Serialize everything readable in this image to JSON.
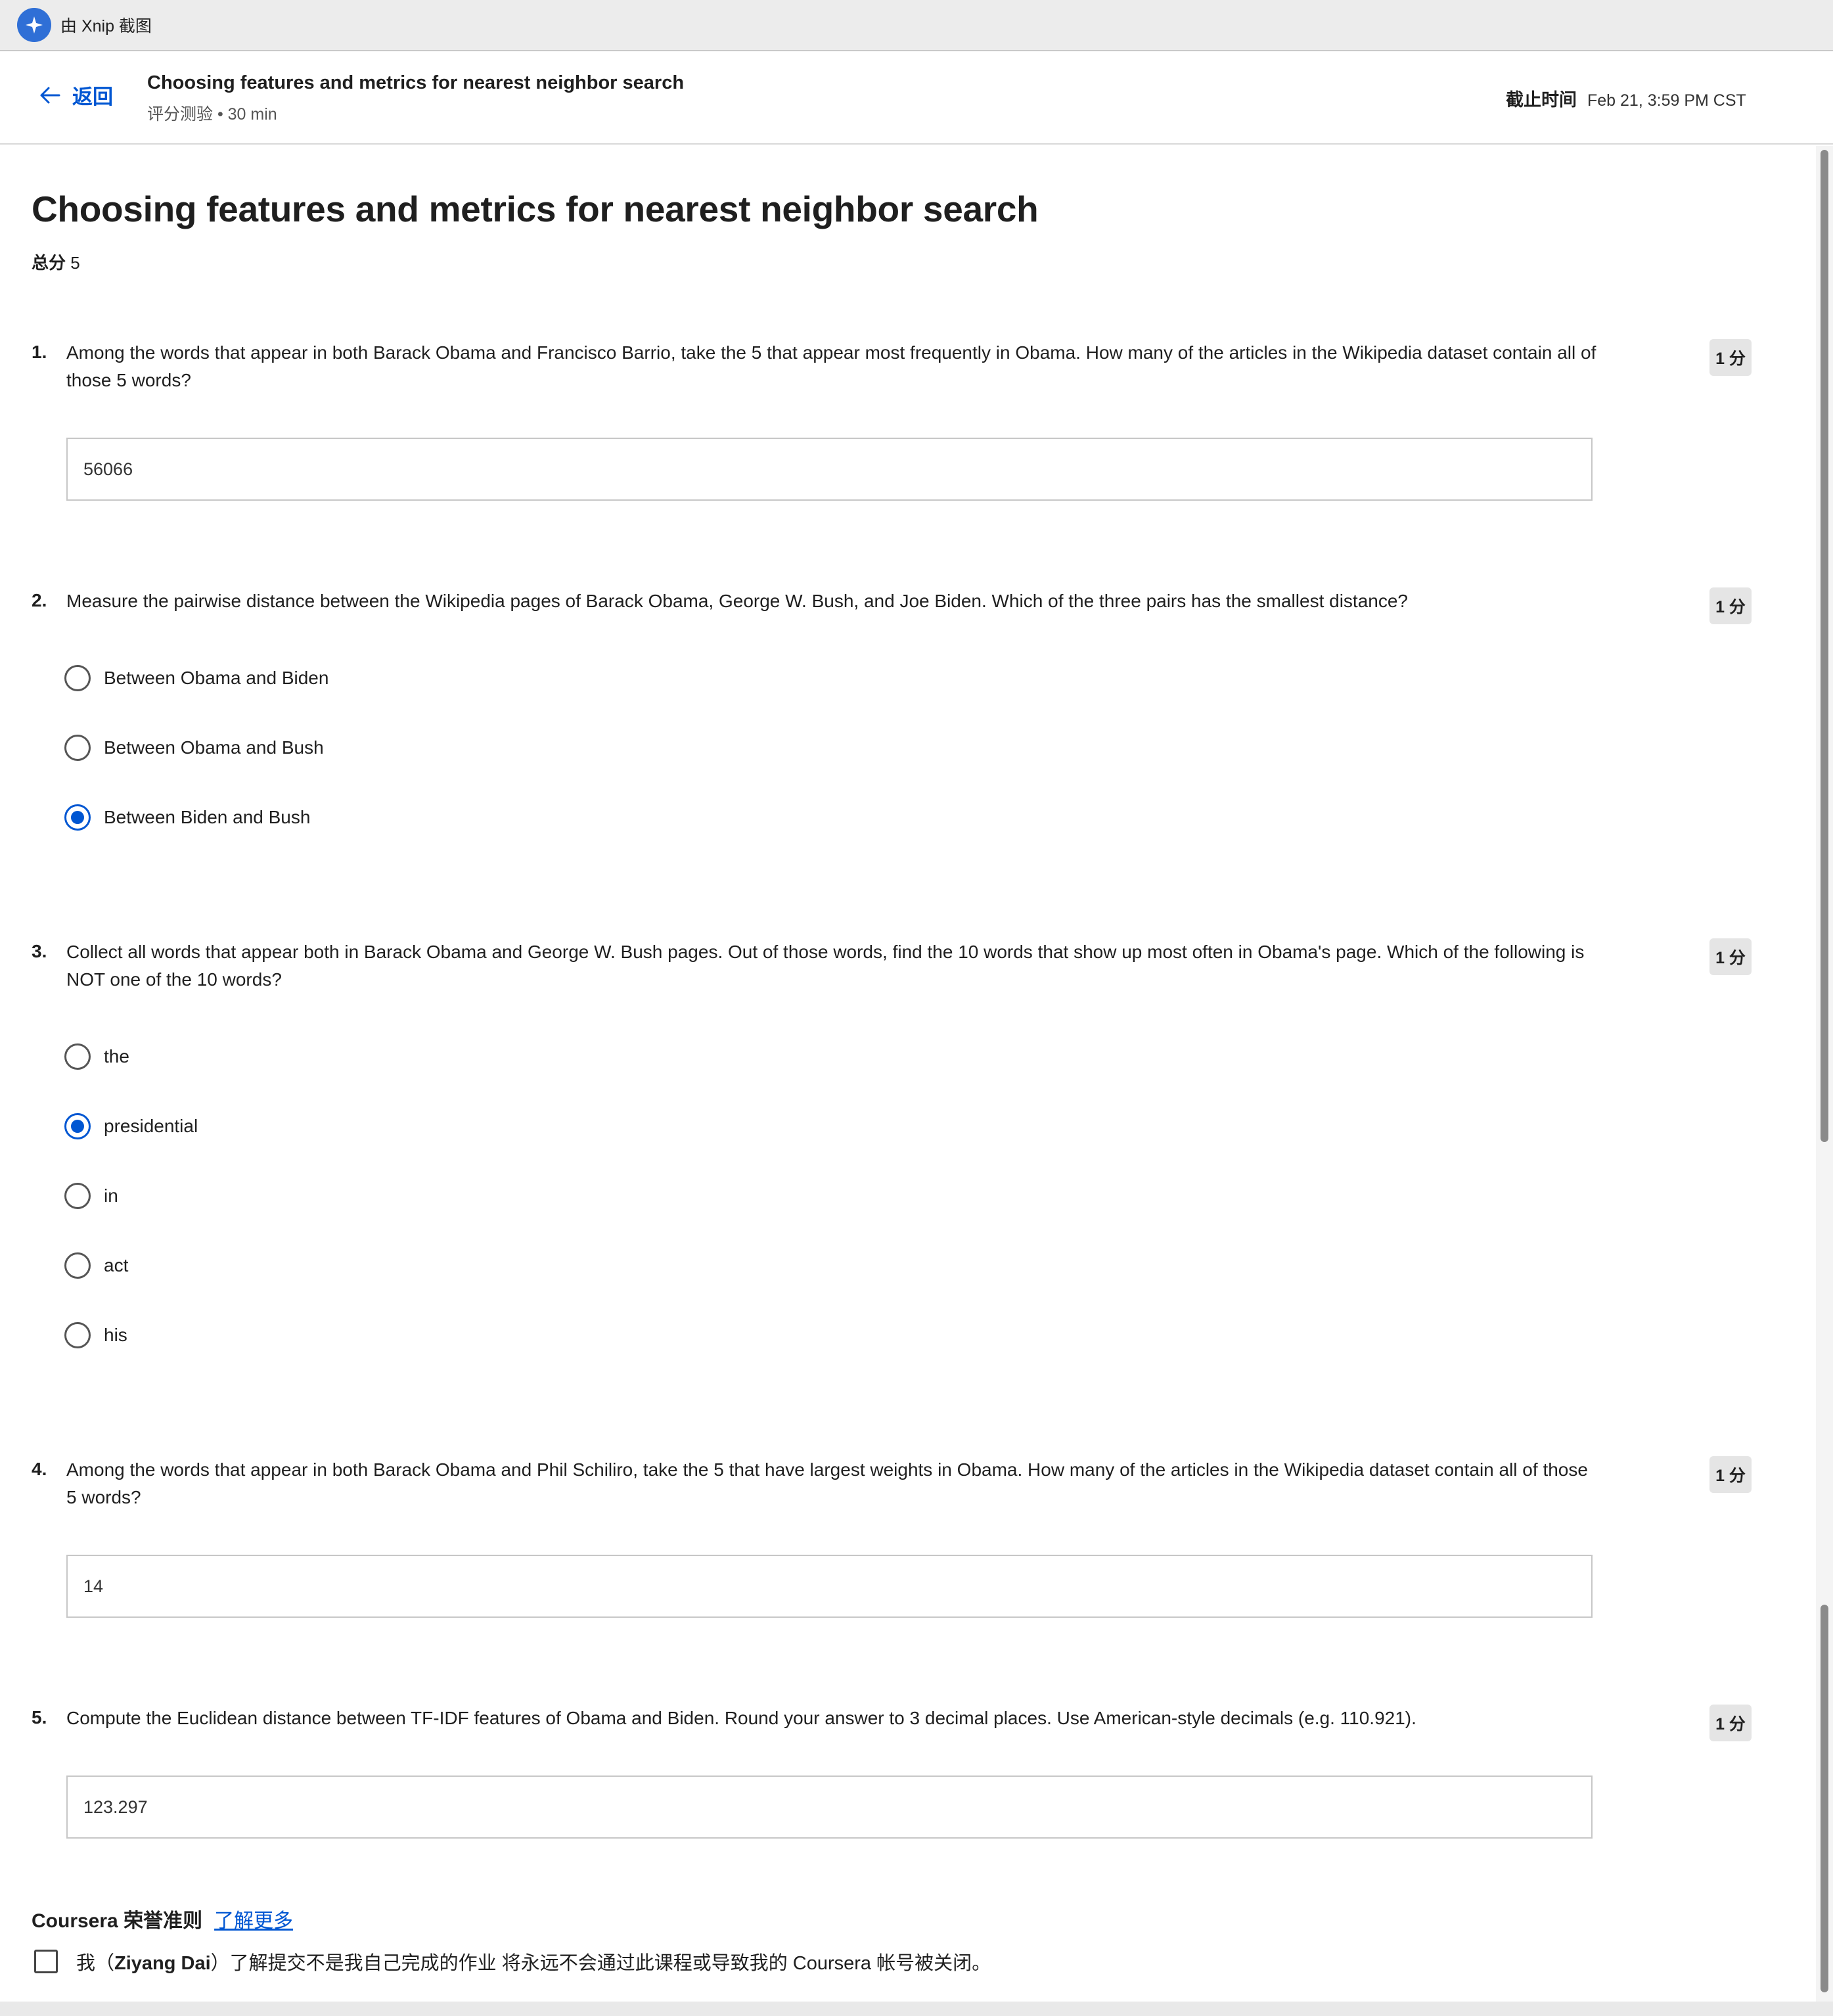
{
  "xnip": {
    "label": "由 Xnip 截图",
    "icon": "xnip-logo-icon"
  },
  "header": {
    "back_label": "返回",
    "title": "Choosing features and metrics for nearest neighbor search",
    "subtitle": "评分测验 • 30 min",
    "deadline_label": "截止时间",
    "deadline_value": "Feb 21, 3:59 PM CST"
  },
  "main": {
    "title": "Choosing features and metrics for nearest neighbor search",
    "total_label": "总分",
    "total_value": "5"
  },
  "questions": [
    {
      "num": "1.",
      "text": "Among the words that appear in both Barack Obama and Francisco Barrio, take the 5 that appear most frequently in Obama. How many of the articles in the Wikipedia dataset contain all of those 5 words?",
      "points": "1 分",
      "answer": "56066"
    },
    {
      "num": "2.",
      "text": "Measure the pairwise distance between the Wikipedia pages of Barack Obama, George W. Bush, and Joe Biden. Which of the three pairs has the smallest distance?",
      "points": "1 分",
      "options": [
        "Between Obama and Biden",
        "Between Obama and Bush",
        "Between Biden and Bush"
      ],
      "selected": "Between Biden and Bush"
    },
    {
      "num": "3.",
      "text": "Collect all words that appear both in Barack Obama and George W. Bush pages. Out of those words, find the 10 words that show up most often in Obama's page. Which of the following is NOT one of the 10 words?",
      "points": "1 分",
      "options": [
        "the",
        "presidential",
        "in",
        "act",
        "his"
      ],
      "selected": "presidential"
    },
    {
      "num": "4.",
      "text": "Among the words that appear in both Barack Obama and Phil Schiliro, take the 5 that have largest weights in Obama. How many of the articles in the Wikipedia dataset contain all of those 5 words?",
      "points": "1 分",
      "answer": "14"
    },
    {
      "num": "5.",
      "text": "Compute the Euclidean distance between TF-IDF features of Obama and Biden. Round your answer to 3 decimal places. Use American-style decimals (e.g. 110.921).",
      "points": "1 分",
      "answer": "123.297"
    }
  ],
  "honor": {
    "title": "Coursera 荣誉准则",
    "link": "了解更多",
    "text_prefix": "我（",
    "name": "Ziyang Dai",
    "text_suffix": "）了解提交不是我自己完成的作业 将永远不会通过此课程或导致我的 Coursera 帐号被关闭。",
    "checked": false
  },
  "colors": {
    "accent": "#0056d2",
    "points_bg": "#e5e5e5",
    "text": "#1f1f1f"
  }
}
